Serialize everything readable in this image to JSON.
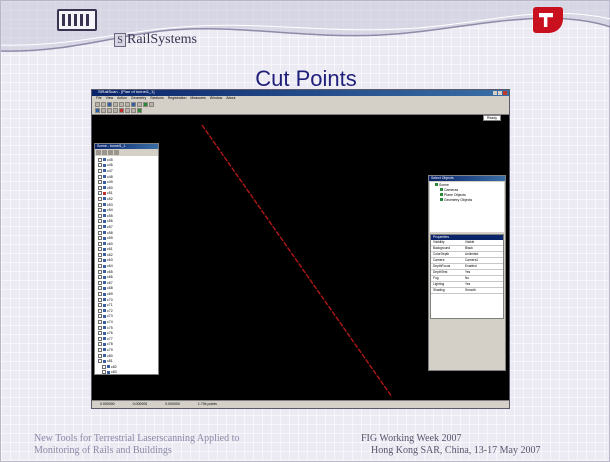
{
  "header": {
    "brand_box": "S",
    "brand_text": "RailSystems",
    "colors": {
      "background": "#eceaf3",
      "title": "#1f1f7a",
      "logo_right": "#c8101e",
      "cut_line": "#b01818"
    }
  },
  "slide": {
    "title": "Cut Points"
  },
  "screenshot": {
    "window_title": "SiRailScan - [Plan of tunnel1_1]",
    "menu": [
      "File",
      "View",
      "Action",
      "Geometry",
      "Sections",
      "Registration",
      "Measures",
      "Window",
      "About"
    ],
    "readout": "Ready",
    "scene_tree": {
      "title": "Scene - tunnel1_1",
      "items": [
        "c45",
        "c46",
        "c47",
        "c48",
        "c49",
        "c50",
        "c51",
        "c52",
        "c53",
        "c54",
        "c55",
        "c56",
        "c57",
        "c58",
        "c59",
        "c60",
        "c61",
        "c62",
        "c63",
        "c64",
        "c65",
        "c66",
        "c67",
        "c68",
        "c69",
        "c70",
        "c71",
        "c72",
        "c73",
        "c74",
        "c75",
        "c76",
        "c77",
        "c78",
        "c79",
        "c80",
        "c81",
        "c82",
        "c83",
        "c84",
        "c85",
        "c86",
        "c87",
        "c88",
        "c89",
        "c90",
        "c91"
      ]
    },
    "select_panel": {
      "title": "Select Objects",
      "items": [
        "Scene",
        "Cameras",
        "Plane Objects",
        "Geometry Objects"
      ]
    },
    "properties": {
      "head": "Properties",
      "rows": [
        {
          "k": "Visibility",
          "v": "Visible"
        },
        {
          "k": "Background",
          "v": "Black"
        },
        {
          "k": "ColorDepth",
          "v": "Unlimited"
        },
        {
          "k": "Camera",
          "v": "Camera1"
        },
        {
          "k": "DepthFocus",
          "v": "Enabled"
        },
        {
          "k": "DepthTest",
          "v": "Yes"
        },
        {
          "k": "Fog",
          "v": "No"
        },
        {
          "k": "Lighting",
          "v": "Yes"
        },
        {
          "k": "Shading",
          "v": "Smooth"
        }
      ]
    },
    "status": [
      "0.000000",
      "0.000000",
      "0.000000",
      "1.794 points"
    ]
  },
  "footer": {
    "left_line1": "New Tools for Terrestrial Laserscanning Applied to",
    "left_line2": "Monitoring of Rails and Buildings",
    "right_line1": "FIG Working Week 2007",
    "right_line2": "Hong Kong SAR, China, 13-17 May 2007"
  }
}
